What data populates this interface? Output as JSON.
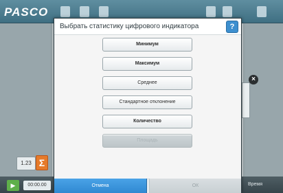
{
  "app": {
    "logo": "PASCO",
    "meter_chip": "1.23",
    "sigma": "Σ",
    "bottom": {
      "timer": "00:00.00",
      "right_label": "Время"
    }
  },
  "dialog": {
    "title": "Выбрать статистику цифрового индикатора",
    "help_label": "?",
    "options": [
      {
        "label": "Минимум"
      },
      {
        "label": "Максимум"
      },
      {
        "label": "Среднее"
      },
      {
        "label": "Стандартное отклонение"
      },
      {
        "label": "Количество"
      },
      {
        "label": "Площадь"
      }
    ],
    "footer": {
      "cancel": "Отмена",
      "ok": "ОК"
    }
  },
  "colors": {
    "accent": "#2e87d0",
    "sigma": "#e57a2a",
    "topbar": "#3f6f82"
  },
  "icons": [
    "help-icon",
    "play-icon",
    "close-icon",
    "sigma-icon"
  ]
}
